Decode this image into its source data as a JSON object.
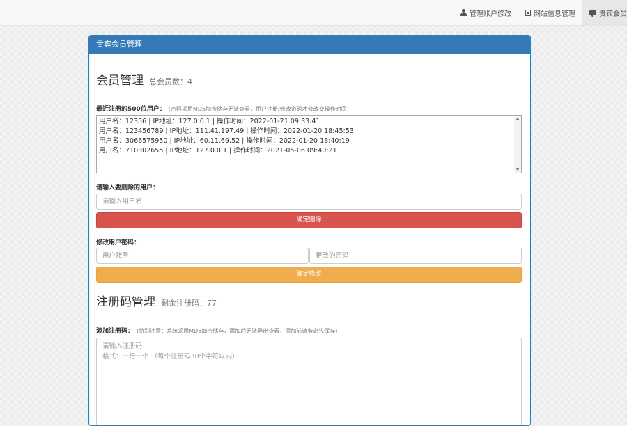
{
  "topnav": {
    "items": [
      {
        "icon": "user-icon",
        "label": "管理账户修改"
      },
      {
        "icon": "list-icon",
        "label": "网站信息管理"
      },
      {
        "icon": "comment-icon",
        "label": "贵宾会员"
      }
    ]
  },
  "panel": {
    "heading": "贵宾会员管理"
  },
  "member_section": {
    "title": "会员管理",
    "count_text": "总会员数：4",
    "recent_label": "最近注册的500位用户：",
    "recent_hint": "(密码采用MD5加密储存无法查看，用户注册/修改密码才会改变操作时间)",
    "log_lines": [
      "用户名：12356  |  IP地址：127.0.0.1  |  操作时间：2022-01-21 09:33:41",
      "用户名：123456789  |  IP地址：111.41.197.49  |  操作时间：2022-01-20 18:45:53",
      "用户名：3066575950  |  IP地址：60.11.69.52  |  操作时间：2022-01-20 18:40:19",
      "用户名：710302655  |  IP地址：127.0.0.1  |  操作时间：2021-05-06 09:40:21"
    ],
    "delete_label": "请输入要删除的用户：",
    "delete_placeholder": "请输入用户名",
    "delete_button": "确定删除",
    "password_label": "修改用户密码：",
    "account_placeholder": "用户账号",
    "new_password_placeholder": "更改的密码",
    "modify_button": "确定修改"
  },
  "code_section": {
    "title": "注册码管理",
    "remaining_text": "剩余注册码：77",
    "add_label": "添加注册码：",
    "add_hint": "(特别注意：系统采用MD5加密储存，添加后无法导出查看，添加前请务必先保存)",
    "textarea_placeholder_1": "请输入注册码",
    "textarea_placeholder_2": "格式：一行一个 （每个注册码30个字符以内）"
  }
}
